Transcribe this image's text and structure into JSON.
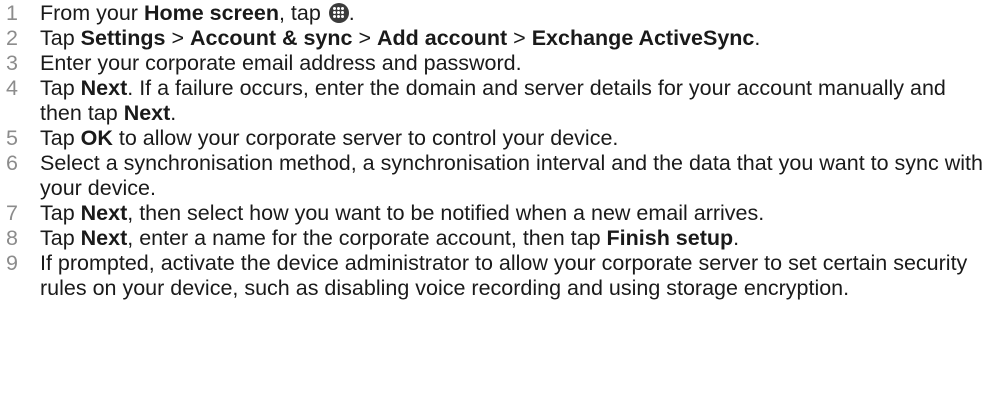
{
  "steps": [
    {
      "number": "1",
      "parts": [
        {
          "text": "From your ",
          "bold": false
        },
        {
          "text": "Home screen",
          "bold": true
        },
        {
          "text": ", tap ",
          "bold": false
        },
        {
          "icon": "apps-icon"
        },
        {
          "text": ".",
          "bold": false
        }
      ]
    },
    {
      "number": "2",
      "parts": [
        {
          "text": "Tap ",
          "bold": false
        },
        {
          "text": "Settings",
          "bold": true
        },
        {
          "text": " > ",
          "bold": false
        },
        {
          "text": "Account & sync",
          "bold": true
        },
        {
          "text": " > ",
          "bold": false
        },
        {
          "text": "Add account",
          "bold": true
        },
        {
          "text": " > ",
          "bold": false
        },
        {
          "text": "Exchange ActiveSync",
          "bold": true
        },
        {
          "text": ".",
          "bold": false
        }
      ]
    },
    {
      "number": "3",
      "parts": [
        {
          "text": "Enter your corporate email address and password.",
          "bold": false
        }
      ]
    },
    {
      "number": "4",
      "parts": [
        {
          "text": "Tap ",
          "bold": false
        },
        {
          "text": "Next",
          "bold": true
        },
        {
          "text": ". If a failure occurs, enter the domain and server details for your account manually and then tap ",
          "bold": false
        },
        {
          "text": "Next",
          "bold": true
        },
        {
          "text": ".",
          "bold": false
        }
      ]
    },
    {
      "number": "5",
      "parts": [
        {
          "text": "Tap ",
          "bold": false
        },
        {
          "text": "OK",
          "bold": true
        },
        {
          "text": " to allow your corporate server to control your device.",
          "bold": false
        }
      ]
    },
    {
      "number": "6",
      "parts": [
        {
          "text": "Select a synchronisation method, a synchronisation interval and the data that you want to sync with your device.",
          "bold": false
        }
      ]
    },
    {
      "number": "7",
      "parts": [
        {
          "text": "Tap ",
          "bold": false
        },
        {
          "text": "Next",
          "bold": true
        },
        {
          "text": ", then select how you want to be notified when a new email arrives.",
          "bold": false
        }
      ]
    },
    {
      "number": "8",
      "parts": [
        {
          "text": "Tap ",
          "bold": false
        },
        {
          "text": "Next",
          "bold": true
        },
        {
          "text": ", enter a name for the corporate account, then tap ",
          "bold": false
        },
        {
          "text": "Finish setup",
          "bold": true
        },
        {
          "text": ".",
          "bold": false
        }
      ]
    },
    {
      "number": "9",
      "parts": [
        {
          "text": "If prompted, activate the device administrator to allow your corporate server to set certain security rules on your device, such as disabling voice recording and using storage encryption.",
          "bold": false
        }
      ]
    }
  ]
}
